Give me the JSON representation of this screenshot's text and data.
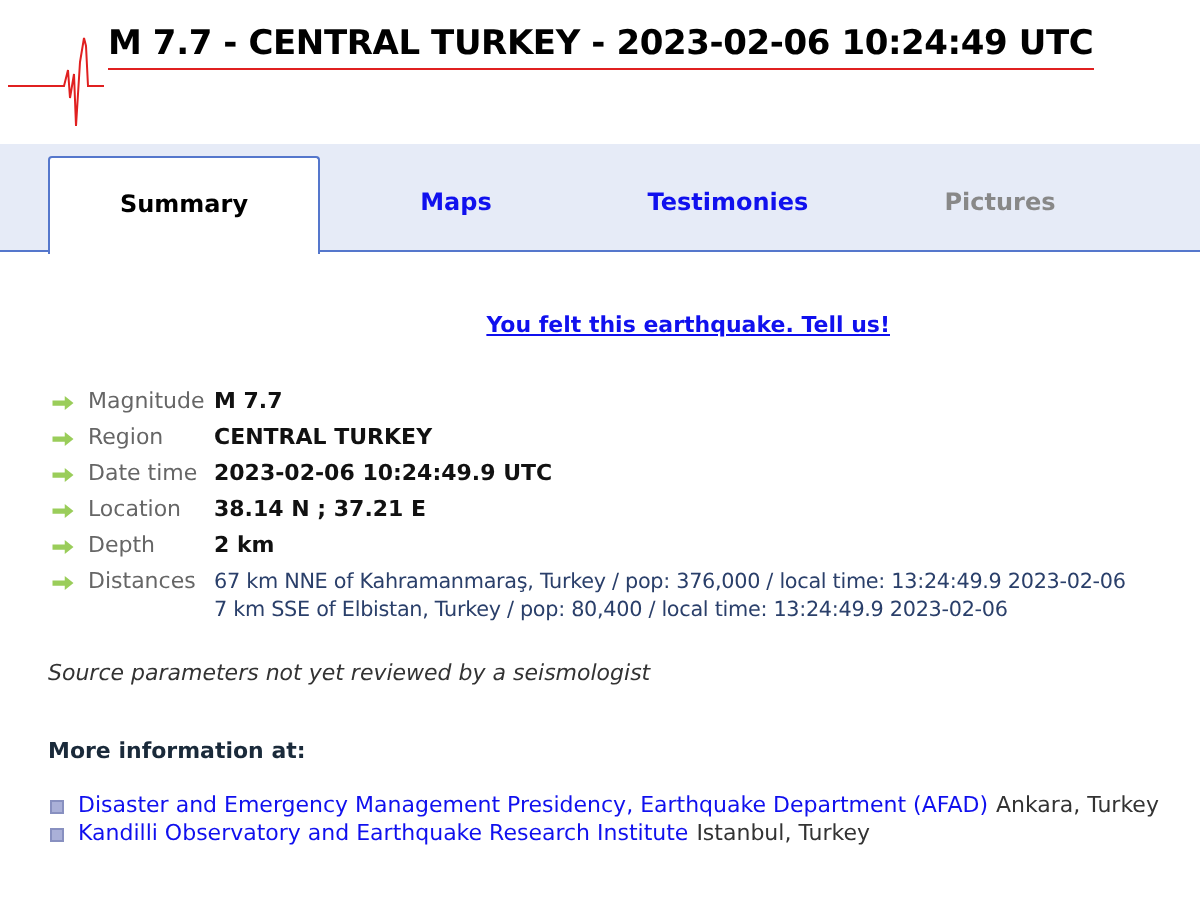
{
  "header": {
    "title": "M 7.7 - CENTRAL TURKEY - 2023-02-06 10:24:49 UTC"
  },
  "tabs": [
    {
      "label": "Summary",
      "selected": true,
      "disabled": false
    },
    {
      "label": "Maps",
      "selected": false,
      "disabled": false
    },
    {
      "label": "Testimonies",
      "selected": false,
      "disabled": false
    },
    {
      "label": "Pictures",
      "selected": false,
      "disabled": true
    }
  ],
  "felt_link": "You felt this earthquake. Tell us!",
  "parameters": [
    {
      "kind": "value",
      "label": "Magnitude",
      "value": "M 7.7"
    },
    {
      "kind": "value",
      "label": "Region",
      "value": "CENTRAL TURKEY"
    },
    {
      "kind": "value",
      "label": "Date time",
      "value": "2023-02-06 10:24:49.9 UTC"
    },
    {
      "kind": "value",
      "label": "Location",
      "value": "38.14 N ; 37.21 E"
    },
    {
      "kind": "value",
      "label": "Depth",
      "value": "2 km"
    },
    {
      "kind": "list",
      "label": "Distances",
      "lines": [
        "67 km NNE of Kahramanmaraş, Turkey / pop: 376,000 / local time: 13:24:49.9 2023-02-06",
        "7 km SSE of Elbistan, Turkey / pop: 80,400 / local time: 13:24:49.9 2023-02-06"
      ]
    }
  ],
  "review_note": "Source parameters not yet reviewed by a seismologist",
  "more_info": {
    "heading": "More information at:",
    "sources": [
      {
        "name": "Disaster and Emergency Management Presidency, Earthquake Department (AFAD)",
        "place": "Ankara, Turkey"
      },
      {
        "name": "Kandilli Observatory and Earthquake Research Institute",
        "place": "Istanbul, Turkey"
      }
    ]
  }
}
